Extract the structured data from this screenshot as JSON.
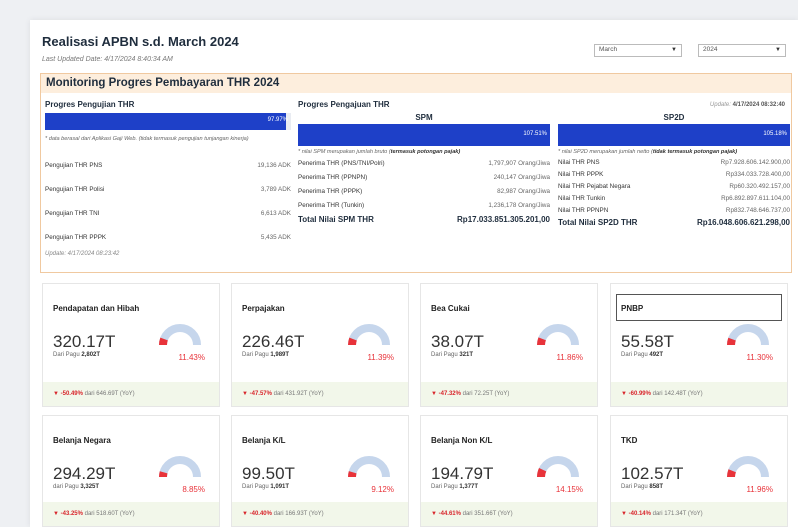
{
  "header": {
    "title": "Realisasi APBN s.d. March 2024",
    "last_updated": "Last Updated Date: 4/17/2024 8:40:34 AM",
    "month_select": "March",
    "year_select": "2024"
  },
  "thr": {
    "title": "Monitoring Progres Pembayaran THR 2024",
    "pengujian": {
      "title": "Progres Pengujian THR",
      "percent": "97.97%",
      "fill": 0.9797,
      "note": "* data berasal dari Aplikasi Gaji Web. (tidak termasuk pengujian tunjangan kinerja)",
      "rows": [
        {
          "label": "Pengujian THR PNS",
          "value": "19,136 ADK"
        },
        {
          "label": "Pengujian THR Polisi",
          "value": "3,789 ADK"
        },
        {
          "label": "Pengujian THR TNI",
          "value": "6,613 ADK"
        },
        {
          "label": "Pengujian THR PPPK",
          "value": "5,435 ADK"
        }
      ],
      "update": "Update: 4/17/2024 08:23:42"
    },
    "pengajuan": {
      "title": "Progres Pengajuan THR",
      "update_label": "Update:",
      "update_value": "4/17/2024 08:32:40",
      "spm": {
        "title": "SPM",
        "percent": "107.51%",
        "fill": 1.0,
        "note_pre": "* nilai SPM merupakan jumlah bruto (",
        "note_bold": "termasuk potongan pajak)",
        "rows": [
          {
            "label": "Penerima THR (PNS/TNI/Polri)",
            "value": "1,797,907 Orang/Jiwa"
          },
          {
            "label": "Penerima THR (PPNPN)",
            "value": "240,147 Orang/Jiwa"
          },
          {
            "label": "Penerima THR (PPPK)",
            "value": "82,987 Orang/Jiwa"
          },
          {
            "label": "Penerima THR (Tunkin)",
            "value": "1,236,178 Orang/Jiwa"
          }
        ],
        "total_label": "Total Nilai SPM THR",
        "total_value": "Rp17.033.851.305.201,00"
      },
      "sp2d": {
        "title": "SP2D",
        "percent": "105.18%",
        "fill": 1.0,
        "note_pre": "* nilai SP2D merupakan jumlah netto (",
        "note_bold": "tidak termasuk potongan pajak)",
        "rows": [
          {
            "label": "Nilai THR PNS",
            "value": "Rp7.928.606.142.900,00"
          },
          {
            "label": "Nilai THR PPPK",
            "value": "Rp334.033.728.400,00"
          },
          {
            "label": "Nilai THR Pejabat Negara",
            "value": "Rp60.320.492.157,00"
          },
          {
            "label": "Nilai THR Tunkin",
            "value": "Rp6.892.897.611.104,00"
          },
          {
            "label": "Nilai THR PPNPN",
            "value": "Rp832.748.646.737,00"
          }
        ],
        "total_label": "Total Nilai SP2D THR",
        "total_value": "Rp16.048.606.621.298,00"
      }
    }
  },
  "cards": [
    {
      "name": "Pendapatan dan Hibah",
      "value": "320.17T",
      "pagu_label": "Dari Pagu",
      "pagu": "2,802T",
      "pct": "11.43%",
      "fill": 0.1143,
      "yoy": "-50.49%",
      "yoy_text": "dari 646.69T (YoY)"
    },
    {
      "name": "Perpajakan",
      "value": "226.46T",
      "pagu_label": "Dari Pagu",
      "pagu": "1,989T",
      "pct": "11.39%",
      "fill": 0.1139,
      "yoy": "-47.57%",
      "yoy_text": "dari 431.92T (YoY)"
    },
    {
      "name": "Bea Cukai",
      "value": "38.07T",
      "pagu_label": "Dari Pagu",
      "pagu": "321T",
      "pct": "11.86%",
      "fill": 0.1186,
      "yoy": "-47.32%",
      "yoy_text": "dari 72.25T (YoY)"
    },
    {
      "name": "PNBP",
      "value": "55.58T",
      "pagu_label": "Dari Pagu",
      "pagu": "492T",
      "pct": "11.30%",
      "fill": 0.113,
      "yoy": "-60.99%",
      "yoy_text": "dari 142.48T (YoY)"
    },
    {
      "name": "Belanja Negara",
      "value": "294.29T",
      "pagu_label": "dari Pagu",
      "pagu": "3,325T",
      "pct": "8.85%",
      "fill": 0.0885,
      "yoy": "-43.25%",
      "yoy_text": "dari 518.60T (YoY)"
    },
    {
      "name": "Belanja K/L",
      "value": "99.50T",
      "pagu_label": "Dari Pagu",
      "pagu": "1,091T",
      "pct": "9.12%",
      "fill": 0.0912,
      "yoy": "-40.40%",
      "yoy_text": "dari 166.93T (YoY)"
    },
    {
      "name": "Belanja Non K/L",
      "value": "194.79T",
      "pagu_label": "Dari Pagu",
      "pagu": "1,377T",
      "pct": "14.15%",
      "fill": 0.1415,
      "yoy": "-44.61%",
      "yoy_text": "dari 351.66T (YoY)"
    },
    {
      "name": "TKD",
      "value": "102.57T",
      "pagu_label": "Dari Pagu",
      "pagu": "858T",
      "pct": "11.96%",
      "fill": 0.1196,
      "yoy": "-40.14%",
      "yoy_text": "dari 171.34T (YoY)"
    }
  ],
  "colors": {
    "gauge_fill": "#e8333a",
    "gauge_track": "#c6d6ec",
    "bar": "#1e40c8",
    "negative": "#d8262c"
  },
  "icons": {
    "yoy": "triangle-down-icon",
    "dropdown": "chevron-down-icon"
  }
}
